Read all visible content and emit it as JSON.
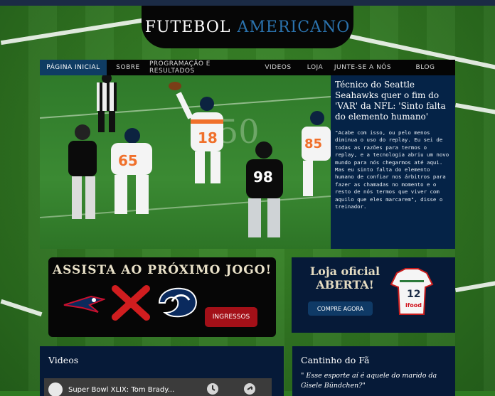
{
  "site": {
    "title_white": "FUTEBOL",
    "title_blue": "AMERICANO"
  },
  "nav": {
    "items": [
      {
        "label": "Página inicial",
        "active": true
      },
      {
        "label": "Sobre"
      },
      {
        "label": "Programação e resultados"
      },
      {
        "label": "Videos"
      },
      {
        "label": "Loja"
      },
      {
        "label": "Junte-se a nós"
      },
      {
        "label": "Blog"
      }
    ]
  },
  "hero": {
    "headline": "Técnico do Seattle Seahawks quer o fim do 'VAR' da NFL: 'Sinto falta do elemento humano'",
    "body": "\"Acabe com isso, ou pelo menos diminua o uso do replay. Eu sei de todas as razões para termos o replay, e a tecnologia abriu um novo mundo para nós chegarmos até aqui. Mas eu sinto falta do elemento humano de confiar nos árbitros para fazer as chamadas no momento e o resto de nós termos que viver com aquilo que eles marcarem\", disse o treinador.",
    "jerseys": {
      "p1": "18",
      "p2": "65",
      "p3": "98",
      "p4": "85"
    }
  },
  "next_game": {
    "title": "ASSISTA AO PRÓXIMO JOGO!",
    "button": "INGRESSOS",
    "colors": {
      "accent_red": "#a31018",
      "vs_red": "#d01d1f"
    }
  },
  "store": {
    "title_line1": "Loja oficial",
    "title_line2": "ABERTA!",
    "button": "COMPRE AGORA",
    "jersey_number": "12",
    "jersey_sponsor": "ifood"
  },
  "videos": {
    "title": "Videos",
    "video_title": "Super Bowl XLIX: Tom Brady..."
  },
  "fan": {
    "title": "Cantinho do Fã",
    "quote": "\" Esse esporte aí é aquele do marido da Gisele Bündchen?\""
  }
}
